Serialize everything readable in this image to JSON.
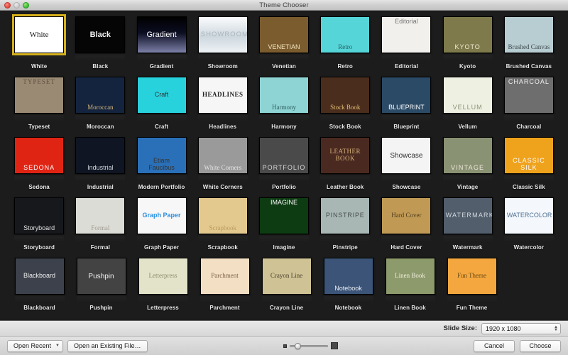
{
  "window": {
    "title": "Theme Chooser",
    "controls": {
      "close": "close",
      "minimize": "minimize",
      "zoom": "zoom"
    }
  },
  "gallery": {
    "selected_index": 0,
    "rows": [
      [
        {
          "label": "White",
          "art": "t-white",
          "text": "White"
        },
        {
          "label": "Black",
          "art": "t-black",
          "text": "Black"
        },
        {
          "label": "Gradient",
          "art": "t-gradient",
          "text": "Gradient"
        },
        {
          "label": "Showroom",
          "art": "t-showroom",
          "text": "SHOWROOM"
        },
        {
          "label": "Venetian",
          "art": "t-venetian",
          "text": "VENETIAN"
        },
        {
          "label": "Retro",
          "art": "t-retro",
          "text": "Retro"
        },
        {
          "label": "Editorial",
          "art": "t-editorial",
          "text": "Editorial"
        },
        {
          "label": "Kyoto",
          "art": "t-kyoto",
          "text": "KYOTO"
        },
        {
          "label": "Brushed Canvas",
          "art": "t-brushed",
          "text": "Brushed Canvas"
        }
      ],
      [
        {
          "label": "Typeset",
          "art": "t-typeset",
          "text": "TYPESET"
        },
        {
          "label": "Moroccan",
          "art": "t-moroccan",
          "text": "Moroccan"
        },
        {
          "label": "Craft",
          "art": "t-craft",
          "text": "Craft"
        },
        {
          "label": "Headlines",
          "art": "t-headlines",
          "text": "HEADLINES"
        },
        {
          "label": "Harmony",
          "art": "t-harmony",
          "text": "Harmony"
        },
        {
          "label": "Stock Book",
          "art": "t-stockbook",
          "text": "Stock Book"
        },
        {
          "label": "Blueprint",
          "art": "t-blueprint",
          "text": "BLUEPRINT"
        },
        {
          "label": "Vellum",
          "art": "t-vellum",
          "text": "VELLUM"
        },
        {
          "label": "Charcoal",
          "art": "t-charcoal",
          "text": "CHARCOAL"
        }
      ],
      [
        {
          "label": "Sedona",
          "art": "t-sedona",
          "text": "SEDONA"
        },
        {
          "label": "Industrial",
          "art": "t-industrial",
          "text": "Industrial"
        },
        {
          "label": "Modern Portfolio",
          "art": "t-modport",
          "text": "Etiam Faucibus"
        },
        {
          "label": "White Corners",
          "art": "t-whitecorn",
          "text": "White Corners"
        },
        {
          "label": "Portfolio",
          "art": "t-portfolio",
          "text": "PORTFOLIO"
        },
        {
          "label": "Leather Book",
          "art": "t-leather",
          "text": "LEATHER BOOK"
        },
        {
          "label": "Showcase",
          "art": "t-showcase",
          "text": "Showcase"
        },
        {
          "label": "Vintage",
          "art": "t-vintage",
          "text": "VINTAGE"
        },
        {
          "label": "Classic Silk",
          "art": "t-silk",
          "text": "CLASSIC SILK"
        }
      ],
      [
        {
          "label": "Storyboard",
          "art": "t-storyboard",
          "text": "Storyboard"
        },
        {
          "label": "Formal",
          "art": "t-formal",
          "text": "Formal"
        },
        {
          "label": "Graph Paper",
          "art": "t-graph",
          "text": "Graph Paper"
        },
        {
          "label": "Scrapbook",
          "art": "t-scrapbook",
          "text": "Scrapbook"
        },
        {
          "label": "Imagine",
          "art": "t-imagine",
          "text": "IMAGINE"
        },
        {
          "label": "Pinstripe",
          "art": "t-pinstripe",
          "text": "PINSTRIPE"
        },
        {
          "label": "Hard Cover",
          "art": "t-hardcover",
          "text": "Hard Cover"
        },
        {
          "label": "Watermark",
          "art": "t-watermark",
          "text": "WATERMARK"
        },
        {
          "label": "Watercolor",
          "art": "t-watercolor",
          "text": "WATERCOLOR"
        }
      ],
      [
        {
          "label": "Blackboard",
          "art": "t-blackboard",
          "text": "Blackboard"
        },
        {
          "label": "Pushpin",
          "art": "t-pushpin",
          "text": "Pushpin"
        },
        {
          "label": "Letterpress",
          "art": "t-letterpress",
          "text": "Letterpress"
        },
        {
          "label": "Parchment",
          "art": "t-parchment",
          "text": "Parchment"
        },
        {
          "label": "Crayon Line",
          "art": "t-crayon",
          "text": "Crayon Line"
        },
        {
          "label": "Notebook",
          "art": "t-notebook",
          "text": "Notebook"
        },
        {
          "label": "Linen Book",
          "art": "t-linen",
          "text": "Linen Book"
        },
        {
          "label": "Fun Theme",
          "art": "t-fun",
          "text": "Fun Theme"
        }
      ]
    ]
  },
  "slide_size": {
    "label": "Slide Size:",
    "value": "1920 x 1080"
  },
  "bottom_bar": {
    "open_recent": "Open Recent",
    "open_existing": "Open an Existing File…",
    "cancel": "Cancel",
    "choose": "Choose",
    "zoom_small_icon": "small-thumbnail-icon",
    "zoom_big_icon": "large-thumbnail-icon",
    "zoom_value": 12
  },
  "colors": {
    "selection": "#d6b019",
    "gallery_bg": "#1c1c1c",
    "chrome": "#dcdcdc"
  }
}
